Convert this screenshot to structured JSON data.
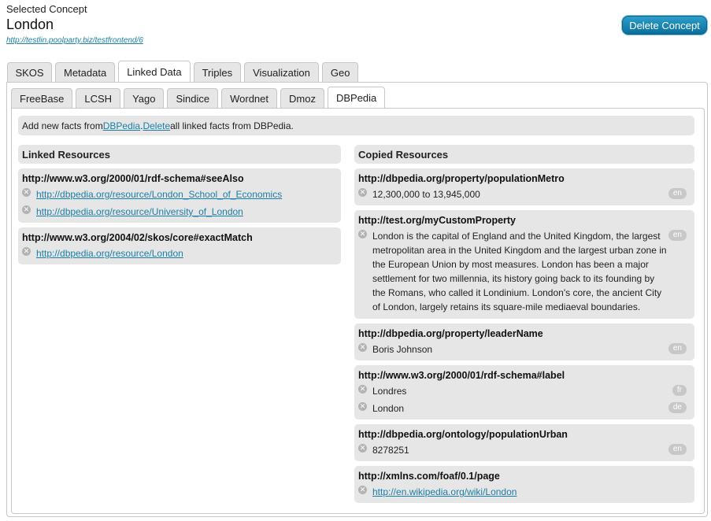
{
  "header": {
    "subtitle": "Selected Concept",
    "title": "London",
    "uri": "http://testlin.poolparty.biz/testfrontend/6",
    "delete_label": "Delete Concept"
  },
  "main_tabs": [
    "SKOS",
    "Metadata",
    "Linked Data",
    "Triples",
    "Visualization",
    "Geo"
  ],
  "active_main_tab": "Linked Data",
  "sub_tabs": [
    "FreeBase",
    "LCSH",
    "Yago",
    "Sindice",
    "Wordnet",
    "Dmoz",
    "DBPedia"
  ],
  "active_sub_tab": "DBPedia",
  "info": {
    "t1": "Add new facts from ",
    "link1": "DBPedia",
    "t2": ". ",
    "link2": "Delete",
    "t3": " all linked facts from DBPedia."
  },
  "linked": {
    "heading": "Linked Resources",
    "groups": [
      {
        "property": "http://www.w3.org/2000/01/rdf-schema#seeAlso",
        "values": [
          "http://dbpedia.org/resource/London_School_of_Economics",
          "http://dbpedia.org/resource/University_of_London"
        ]
      },
      {
        "property": "http://www.w3.org/2004/02/skos/core#exactMatch",
        "values": [
          "http://dbpedia.org/resource/London"
        ]
      }
    ]
  },
  "copied": {
    "heading": "Copied Resources",
    "groups": [
      {
        "property": "http://dbpedia.org/property/populationMetro",
        "values": [
          {
            "text": "12,300,000 to 13,945,000",
            "lang": "en"
          }
        ]
      },
      {
        "property": "http://test.org/myCustomProperty",
        "values": [
          {
            "text": "London is the capital of England and the United Kingdom, the largest metropolitan area in the United Kingdom and the largest urban zone in the European Union by most measures. London has been a major settlement for two millennia, its history going back to its founding by the Romans, who called it Londinium. London's core, the ancient City of London, largely retains its square-mile mediaeval boundaries.",
            "lang": "en"
          }
        ]
      },
      {
        "property": "http://dbpedia.org/property/leaderName",
        "values": [
          {
            "text": "Boris Johnson",
            "lang": "en"
          }
        ]
      },
      {
        "property": "http://www.w3.org/2000/01/rdf-schema#label",
        "values": [
          {
            "text": "Londres",
            "lang": "fr"
          },
          {
            "text": "London",
            "lang": "de"
          }
        ]
      },
      {
        "property": "http://dbpedia.org/ontology/populationUrban",
        "values": [
          {
            "text": "8278251",
            "lang": "en"
          }
        ]
      },
      {
        "property": "http://xmlns.com/foaf/0.1/page",
        "values": [
          {
            "text": "http://en.wikipedia.org/wiki/London",
            "lang": ""
          }
        ]
      }
    ]
  },
  "icons": {
    "remove": "remove-circle-icon"
  },
  "colors": {
    "accent": "#0a6f9c",
    "link": "#1a7fa8",
    "panel": "#e6e6e6"
  }
}
